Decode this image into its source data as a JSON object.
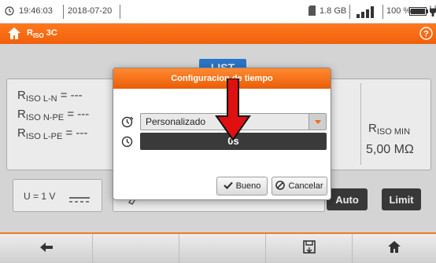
{
  "status": {
    "time": "19:46:03",
    "date": "2018-07-20",
    "storage": "1.8 GB",
    "battery": "100 %"
  },
  "title": {
    "label": "R",
    "label_sub": "ISO",
    "label_rest": " 3C"
  },
  "tab": {
    "label": "LIST"
  },
  "measurements": [
    {
      "prefix": "R",
      "sub": "ISO L-N",
      "value": "= ---"
    },
    {
      "prefix": "R",
      "sub": "ISO N-PE",
      "value": "= ---"
    },
    {
      "prefix": "R",
      "sub": "ISO L-PE",
      "value": "= ---"
    }
  ],
  "rmin": {
    "prefix": "R",
    "sub": "ISO MIN",
    "value": "5,00 MΩ"
  },
  "voltage": {
    "label": "U = 1 V"
  },
  "buttons": {
    "auto": "Auto",
    "limit": "Limit"
  },
  "modal": {
    "title": "Configuracion de tiempo",
    "select_value": "Personalizado",
    "time_value": "0s",
    "ok_label": "Bueno",
    "cancel_label": "Cancelar"
  },
  "colors": {
    "accent": "#f26a12",
    "dark": "#3d3d3d",
    "tab_blue": "#2f7fd8",
    "arrow_red": "#e01010"
  }
}
